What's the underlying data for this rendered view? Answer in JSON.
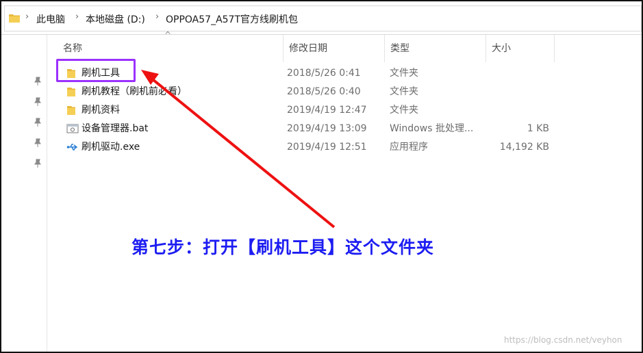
{
  "breadcrumb": {
    "items": [
      "此电脑",
      "本地磁盘 (D:)",
      "OPPOA57_A57T官方线刷机包"
    ]
  },
  "columns": {
    "name": "名称",
    "date": "修改日期",
    "type": "类型",
    "size": "大小"
  },
  "files": [
    {
      "icon": "folder-icon",
      "name": "刷机工具",
      "date": "2018/5/26 0:41",
      "type": "文件夹",
      "size": ""
    },
    {
      "icon": "folder-icon",
      "name": "刷机教程（刷机前必看）",
      "date": "2018/5/26 0:40",
      "type": "文件夹",
      "size": ""
    },
    {
      "icon": "folder-icon",
      "name": "刷机资料",
      "date": "2019/4/19 12:47",
      "type": "文件夹",
      "size": ""
    },
    {
      "icon": "batch-file-icon",
      "name": "设备管理器.bat",
      "date": "2019/4/19 13:09",
      "type": "Windows 批处理...",
      "size": "1 KB"
    },
    {
      "icon": "usb-icon",
      "name": "刷机驱动.exe",
      "date": "2019/4/19 12:51",
      "type": "应用程序",
      "size": "14,192 KB"
    }
  ],
  "annotation": {
    "instruction": "第七步：打开【刷机工具】这个文件夹",
    "arrow_color": "#ee1111",
    "highlight_color": "#9b30ff",
    "text_color": "#1d1df2"
  },
  "watermark": "https://blog.csdn.net/veyhon"
}
